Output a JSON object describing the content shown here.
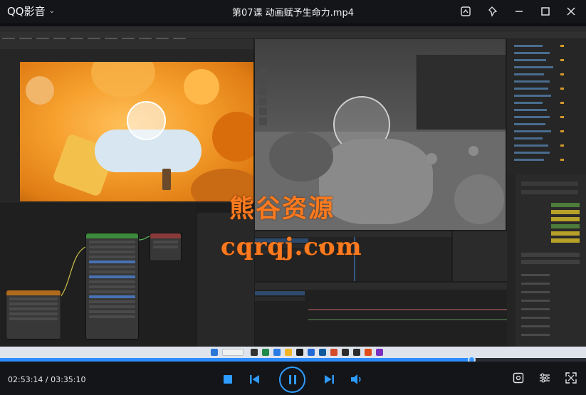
{
  "app": {
    "name": "QQ影音",
    "video_title": "第07课 动画赋予生命力.mp4"
  },
  "watermark": {
    "line1": "熊谷资源",
    "line2": "cqrqj.com"
  },
  "player": {
    "current_time": "02:53:14",
    "total_time": "03:35:10",
    "time_separator": " / ",
    "progress_fraction": 0.806
  },
  "icons": {
    "menu": "chevron-down-icon",
    "screenshot": "capture-icon",
    "pin": "pin-icon",
    "minimize": "minimize-icon",
    "maximize": "maximize-icon",
    "close": "close-icon",
    "stop": "stop-icon",
    "prev": "previous-icon",
    "play_pause": "pause-icon",
    "next": "next-icon",
    "volume": "volume-icon",
    "snapshot": "snapshot-icon",
    "settings": "equalizer-icon",
    "fullscreen": "fullscreen-icon"
  },
  "colors": {
    "accent": "#2e9bff",
    "watermark": "#ff7a1f"
  }
}
